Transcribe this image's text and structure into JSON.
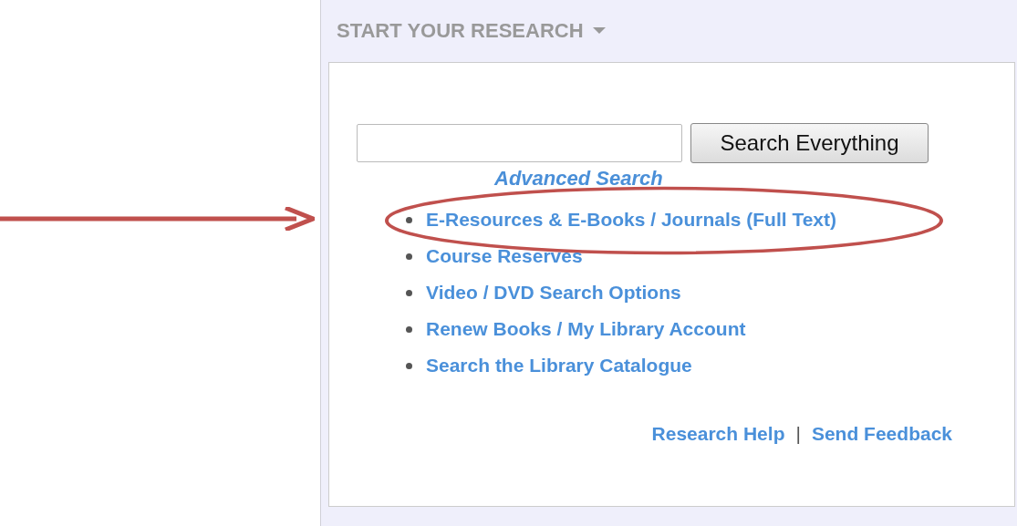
{
  "panel": {
    "title": "START YOUR RESEARCH"
  },
  "search": {
    "button": "Search Everything",
    "advanced_link": "Advanced Search"
  },
  "links": [
    {
      "label": "E-Resources & E-Books / Journals (Full Text)",
      "highlighted": true
    },
    {
      "label": "Course Reserves",
      "highlighted": false
    },
    {
      "label": "Video / DVD Search Options",
      "highlighted": false
    },
    {
      "label": "Renew Books / My Library Account",
      "highlighted": false
    },
    {
      "label": "Search the Library Catalogue",
      "highlighted": false
    }
  ],
  "footer": {
    "links": [
      "Research Help",
      "Send Feedback"
    ],
    "separator": "|"
  }
}
